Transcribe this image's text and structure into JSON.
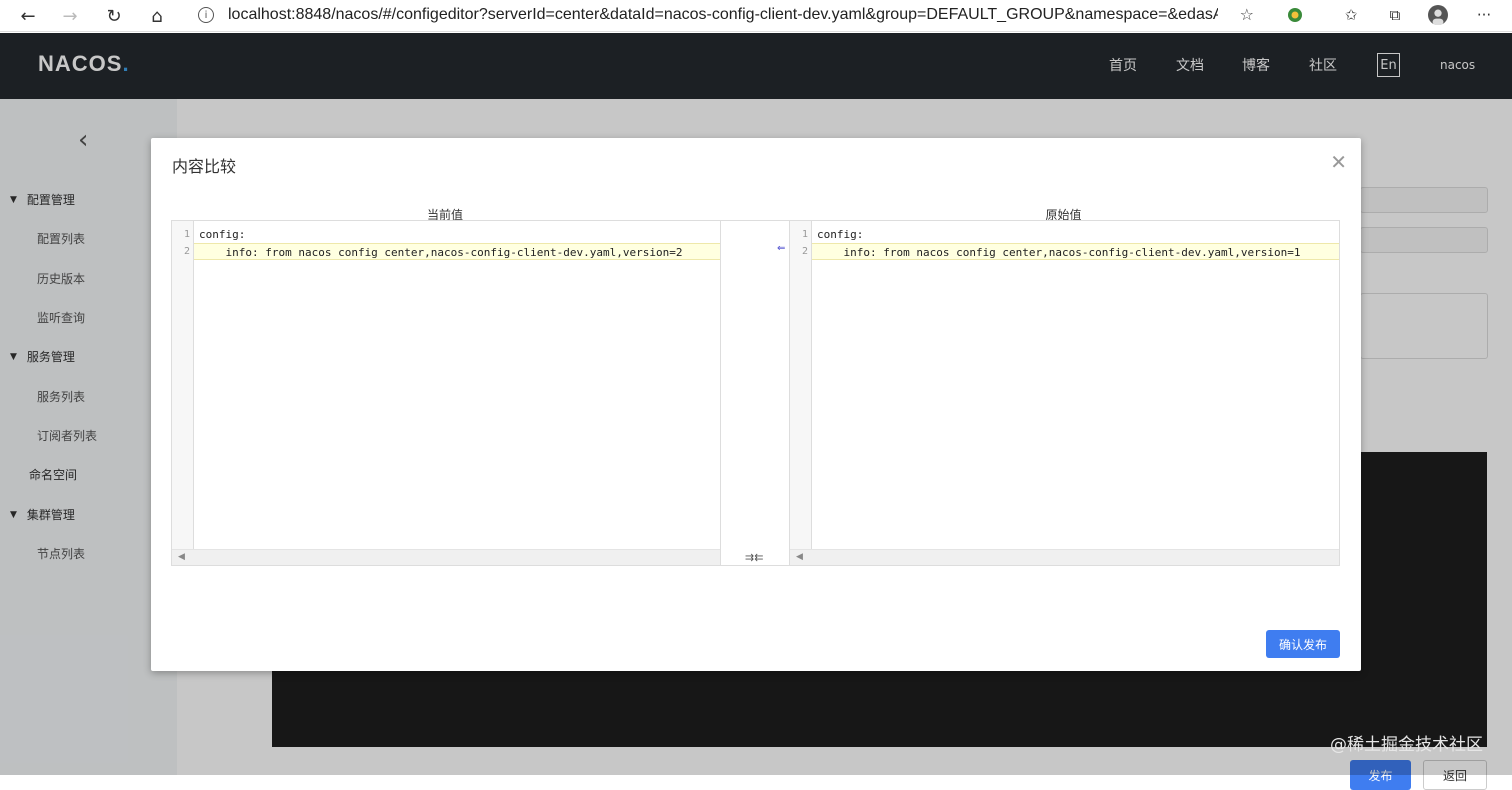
{
  "browser": {
    "url": "localhost:8848/nacos/#/configeditor?serverId=center&dataId=nacos-config-client-dev.yaml&group=DEFAULT_GROUP&namespace=&edasA…",
    "back_glyph": "←",
    "forward_glyph": "→",
    "reload_glyph": "↻",
    "home_glyph": "⌂",
    "info_glyph": "i",
    "star_glyph": "☆",
    "favorites_glyph": "✩",
    "collections_glyph": "⧉",
    "more_glyph": "···"
  },
  "header": {
    "logo_text": "NACOS",
    "logo_dot": ".",
    "nav": [
      "首页",
      "文档",
      "博客",
      "社区"
    ],
    "lang_button": "En",
    "user": "nacos"
  },
  "sidebar": {
    "collapse_glyph": "‹",
    "config_group": "配置管理",
    "config_items": [
      "配置列表",
      "历史版本",
      "监听查询"
    ],
    "service_group": "服务管理",
    "service_items": [
      "服务列表",
      "订阅者列表"
    ],
    "namespace": "命名空间",
    "cluster_group": "集群管理",
    "cluster_items": [
      "节点列表"
    ]
  },
  "background": {
    "publish_button": "发布",
    "back_button": "返回",
    "watermark": "@稀土掘金技术社区"
  },
  "dialog": {
    "title": "内容比较",
    "close_glyph": "✕",
    "current_label": "当前值",
    "original_label": "原始值",
    "left_lines": [
      "config:",
      "    info: from nacos config center,nacos-config-client-dev.yaml,version=2"
    ],
    "right_lines": [
      "config:",
      "    info: from nacos config center,nacos-config-client-dev.yaml,version=1"
    ],
    "line_numbers": [
      "1",
      "2"
    ],
    "revert_glyph": "⇐",
    "sync_glyph": "⇉⇇",
    "confirm_button": "确认发布"
  },
  "colors": {
    "header_bg": "#252a2f",
    "accent": "#3f7df0",
    "changed_line_bg": "#ffffe0"
  }
}
